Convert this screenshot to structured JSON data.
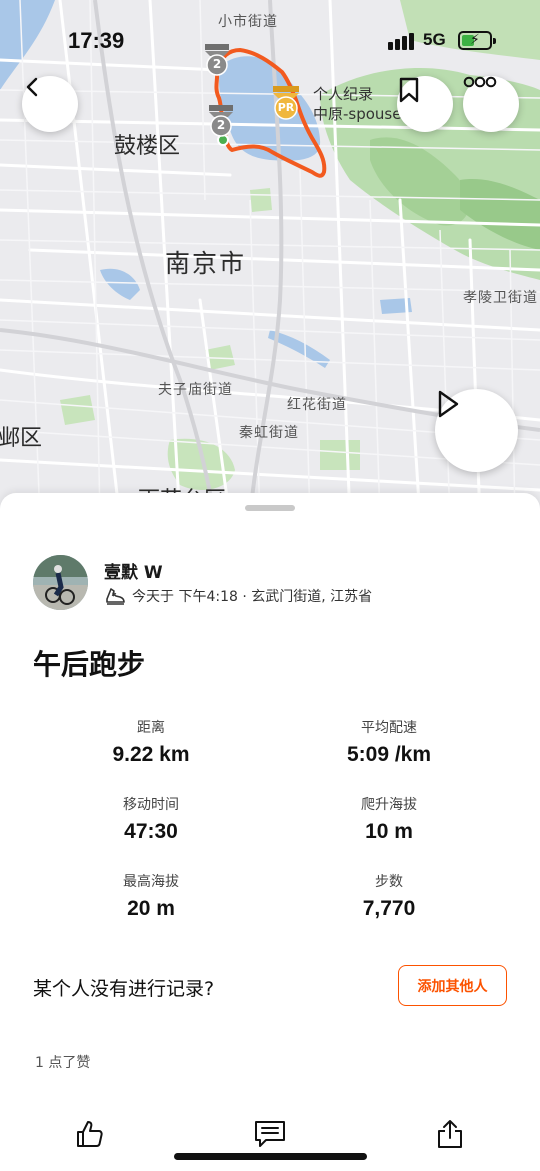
{
  "status_bar": {
    "time": "17:39",
    "network": "5G"
  },
  "map": {
    "labels": {
      "district_gulou": "鼓楼区",
      "city": "南京市",
      "street_xiaoshi": "小市街道",
      "street_xiaoling": "孝陵卫街道",
      "street_fuzimiao": "夫子庙街道",
      "street_honghua": "红花街道",
      "street_qinhong": "秦虹街道",
      "district_partial_left": "邺区",
      "district_partial_bottom": "雨花台区",
      "poi_line1": "个人纪录",
      "poi_line2": "中原-spouse-ien"
    },
    "markers": {
      "segment_badge_1": "2",
      "segment_badge_2": "2",
      "pr_badge": "PR"
    },
    "colors": {
      "route": "#f25a1f",
      "water": "#a9c7e8",
      "park": "#b9dcae",
      "pr_badge": "#f0b73e",
      "segment_badge": "#8a8a8a"
    }
  },
  "header_buttons": {
    "back_icon": "chevron-left",
    "bookmark_icon": "bookmark",
    "more_icon": "ellipsis",
    "play_icon": "play"
  },
  "activity": {
    "user_name": "壹默 W",
    "meta": "今天于 下午4:18 · 玄武门街道, 江苏省",
    "title": "午后跑步",
    "stats": {
      "distance_label": "距离",
      "distance_value": "9.22 km",
      "pace_label": "平均配速",
      "pace_value": "5:09 /km",
      "moving_time_label": "移动时间",
      "moving_time_value": "47:30",
      "elev_gain_label": "爬升海拔",
      "elev_gain_value": "10 m",
      "max_elev_label": "最高海拔",
      "max_elev_value": "20 m",
      "steps_label": "步数",
      "steps_value": "7,770"
    },
    "record_question": "某个人没有进行记录?",
    "add_others_button": "添加其他人",
    "likes": "1 点了赞"
  },
  "accent_color": "#fc5200"
}
